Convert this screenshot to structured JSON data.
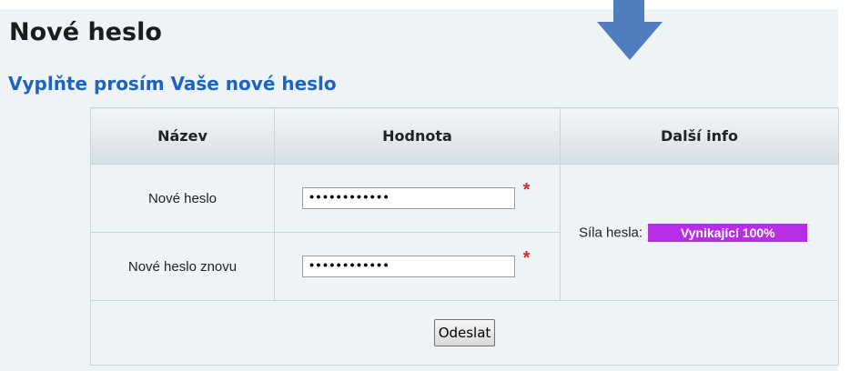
{
  "page": {
    "title": "Nové heslo",
    "subtitle": "Vyplňte prosím Vaše nové heslo"
  },
  "table": {
    "headers": [
      "Název",
      "Hodnota",
      "Další info"
    ],
    "rows": [
      {
        "label": "Nové heslo",
        "value": "••••••••••••",
        "required_mark": "*"
      },
      {
        "label": "Nové heslo znovu",
        "value": "••••••••••••",
        "required_mark": "*"
      }
    ],
    "info": {
      "strength_label": "Síla hesla:",
      "strength_value": "Vynikající 100%",
      "strength_level": 1.0,
      "strength_color": "#b82ee4"
    },
    "submit_label": "Odeslat"
  },
  "icons": {
    "pointer": "down-arrow-icon"
  },
  "colors": {
    "subtitle": "#1c63c4",
    "panel_background": "#eef4f5",
    "arrow": "#4f7dc0",
    "required": "#e0242a"
  }
}
